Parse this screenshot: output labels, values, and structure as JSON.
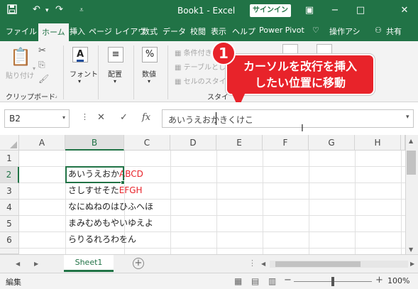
{
  "titlebar": {
    "save_icon": "save-icon",
    "undo_icon": "undo-icon",
    "redo_icon": "redo-icon",
    "customize_icon": "customize-quick-access-icon",
    "title": "Book1  -  Excel",
    "signin": "サインイン"
  },
  "tabs": [
    "ファイル",
    "ホーム",
    "挿入",
    "ページ レイアウ",
    "数式",
    "データ",
    "校閲",
    "表示",
    "ヘルプ",
    "Power Pivot",
    "操作アシ",
    "共有"
  ],
  "ribbon": {
    "paste": "貼り付け",
    "clipboard": "クリップボード",
    "font": "フォント",
    "alignment": "配置",
    "number": "数値",
    "cond_format": "条件付き",
    "table_format": "テーブルとし",
    "cell_style": "セルのスタイル",
    "styles": "スタイ"
  },
  "callout": {
    "number": "1",
    "line1": "カーソルを改行を挿入",
    "line2": "したい位置に移動"
  },
  "formula_bar": {
    "name_box": "B2",
    "cancel": "✕",
    "enter": "✓",
    "fx": "fx",
    "value": "あいうえおかきくけこ"
  },
  "grid": {
    "columns": [
      "A",
      "B",
      "C",
      "D",
      "E",
      "F",
      "G",
      "H"
    ],
    "rows": [
      "1",
      "2",
      "3",
      "4",
      "5",
      "6"
    ],
    "cells": [
      {
        "row": "2",
        "text": "あいうえおか",
        "red": "ABCD"
      },
      {
        "row": "3",
        "text": "さしすせそた",
        "red": "EFGH"
      },
      {
        "row": "4",
        "text": "なにぬねのはひふへほ",
        "red": ""
      },
      {
        "row": "5",
        "text": "まみむめもやいゆえよ",
        "red": ""
      },
      {
        "row": "6",
        "text": "らりるれろわをん",
        "red": ""
      }
    ]
  },
  "sheets": {
    "active": "Sheet1",
    "add": "+"
  },
  "statusbar": {
    "mode": "編集",
    "zoom": "100%",
    "zoom_minus": "−",
    "zoom_plus": "+"
  },
  "colors": {
    "accent": "#217346",
    "callout": "#e8232a"
  }
}
